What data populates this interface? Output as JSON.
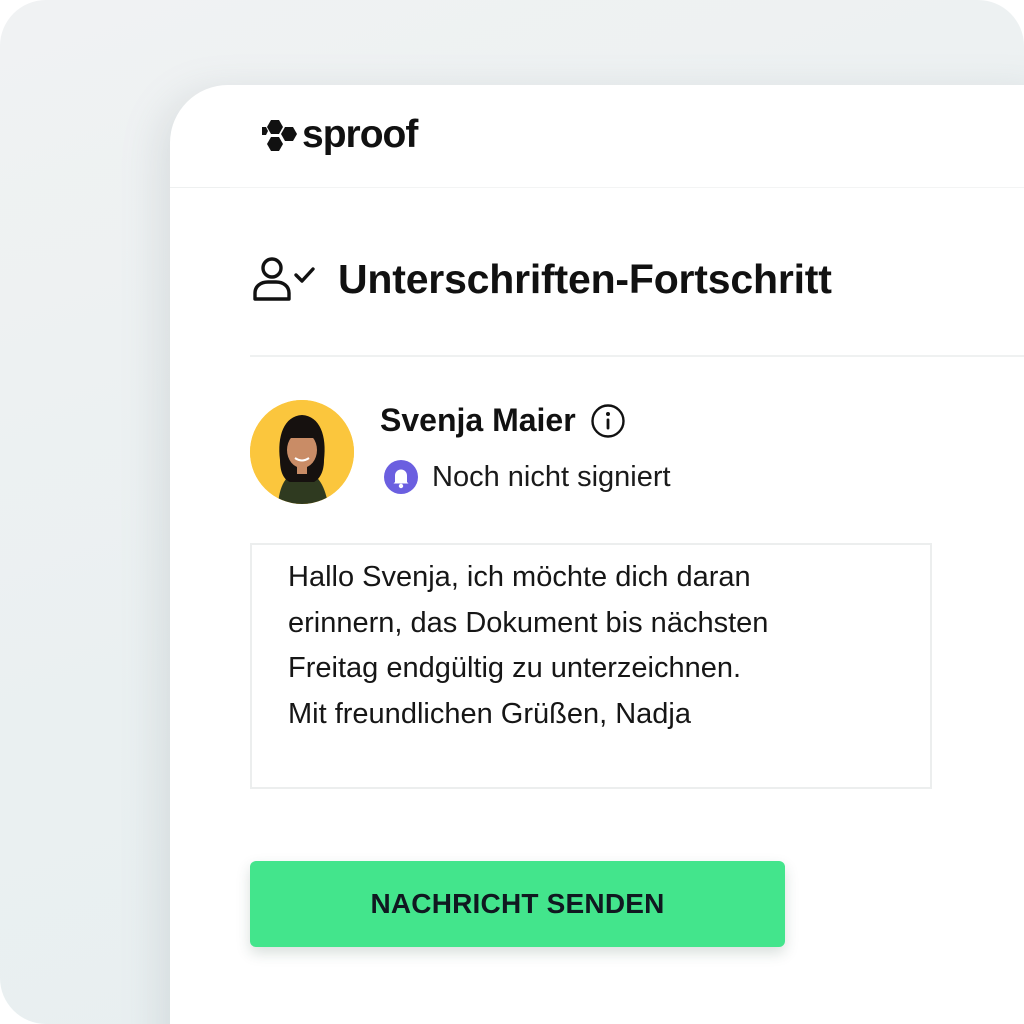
{
  "brand": {
    "name": "sproof",
    "accent_color": "#43e58c",
    "status_color": "#6b5fe0",
    "avatar_bg": "#fbc63d"
  },
  "header": {
    "title": "Unterschriften-Fortschritt",
    "title_icon": "user-check-icon"
  },
  "signer": {
    "name": "Svenja Maier",
    "name_icon": "info-icon",
    "status": "Noch nicht signiert",
    "status_icon": "bell-icon"
  },
  "message": {
    "text": "Hallo Svenja, ich möchte dich daran\nerinnern, das Dokument bis nächsten\nFreitag endgültig zu unterzeichnen.\nMit freundlichen Grüßen, Nadja"
  },
  "actions": {
    "send_label": "NACHRICHT SENDEN"
  }
}
